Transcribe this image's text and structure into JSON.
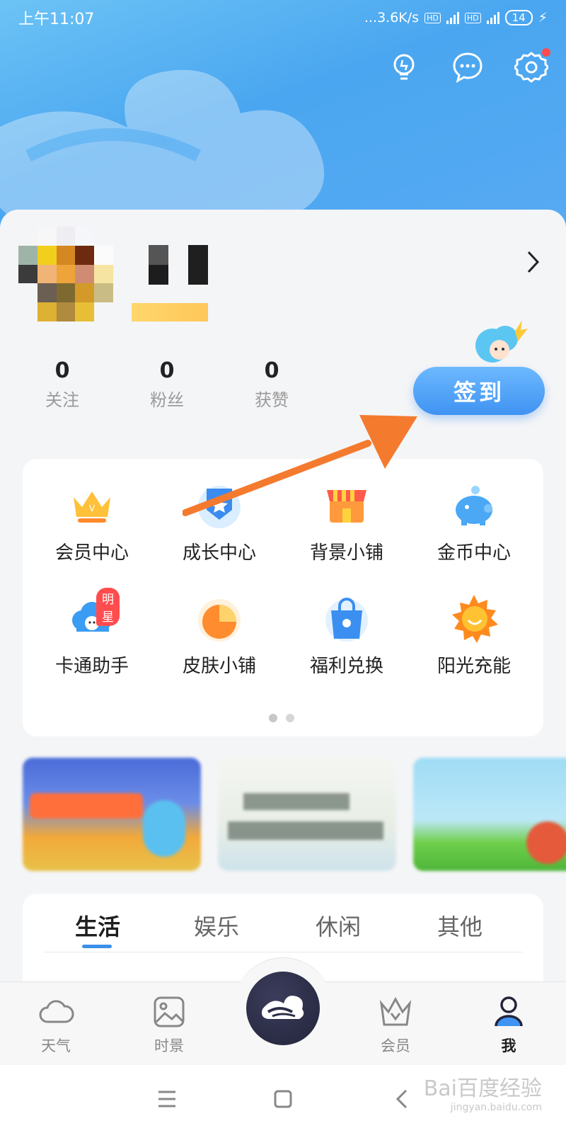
{
  "status_bar": {
    "time": "上午11:07",
    "net_speed": "...3.6K/s",
    "hd": "HD",
    "net_type": "4G",
    "battery": "14"
  },
  "header": {
    "icons": [
      "bulb-icon",
      "chat-icon",
      "settings-icon"
    ]
  },
  "stats": [
    {
      "num": "0",
      "label": "关注"
    },
    {
      "num": "0",
      "label": "粉丝"
    },
    {
      "num": "0",
      "label": "获赞"
    }
  ],
  "sign_in": {
    "label": "签到"
  },
  "services": {
    "items": [
      {
        "label": "会员中心",
        "icon": "crown-icon"
      },
      {
        "label": "成长中心",
        "icon": "growth-badge-icon"
      },
      {
        "label": "背景小铺",
        "icon": "shop-icon"
      },
      {
        "label": "金币中心",
        "icon": "piggy-bank-icon"
      },
      {
        "label": "卡通助手",
        "icon": "cartoon-cloud-icon",
        "badge": "明星"
      },
      {
        "label": "皮肤小铺",
        "icon": "pie-icon"
      },
      {
        "label": "福利兑换",
        "icon": "bag-icon"
      },
      {
        "label": "阳光充能",
        "icon": "sun-icon"
      }
    ]
  },
  "tabs": [
    "生活",
    "娱乐",
    "休闲",
    "其他"
  ],
  "bottom_nav": [
    {
      "label": "天气",
      "icon": "cloud-icon"
    },
    {
      "label": "时景",
      "icon": "image-icon"
    },
    {
      "label": "会员",
      "icon": "crown-outline-icon"
    },
    {
      "label": "我",
      "icon": "profile-icon"
    }
  ],
  "watermark": {
    "main": "Bai百度经验",
    "sub": "jingyan.baidu.com"
  },
  "colors": {
    "accent": "#3f93f2",
    "header": "#4aa6f0",
    "arrow": "#f47a2e"
  }
}
